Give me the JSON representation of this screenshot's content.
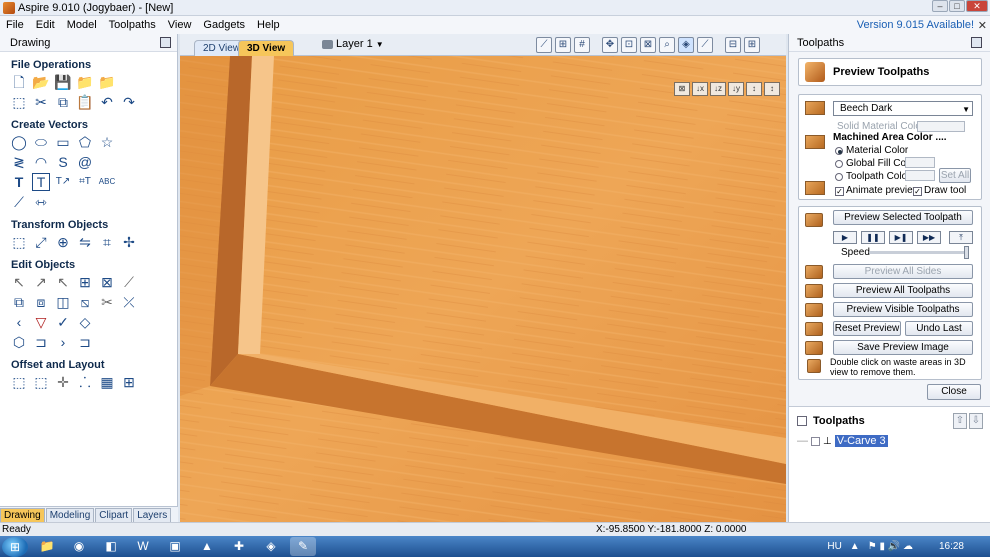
{
  "window": {
    "title": "Aspire 9.010 (Jogybaer) - [New]"
  },
  "menu": {
    "items": [
      "File",
      "Edit",
      "Model",
      "Toolpaths",
      "View",
      "Gadgets",
      "Help"
    ],
    "version_notice": "Version 9.015 Available!"
  },
  "left_panel": {
    "title": "Drawing",
    "sections": [
      {
        "title": "File Operations"
      },
      {
        "title": "Create Vectors"
      },
      {
        "title": "Transform Objects"
      },
      {
        "title": "Edit Objects"
      },
      {
        "title": "Offset and Layout"
      }
    ],
    "tabs": [
      "Drawing",
      "Modeling",
      "Clipart",
      "Layers"
    ]
  },
  "view": {
    "tabs": [
      "2D View",
      "3D View"
    ],
    "active_tab": "3D View",
    "layer_label": "Layer 1"
  },
  "status": {
    "left": "Ready",
    "coords": "X:-95.8500 Y:-181.8000 Z: 0.0000"
  },
  "right_panel": {
    "title": "Toolpaths",
    "preview_title": "Preview Toolpaths",
    "material": {
      "selected": "Beech Dark",
      "solid_color_label": "Solid Material Color"
    },
    "machined_area": {
      "title": "Machined Area Color ....",
      "options": [
        "Material Color",
        "Global Fill Color",
        "Toolpath Color"
      ],
      "selected": "Material Color",
      "set_all": "Set All"
    },
    "checks": {
      "animate": "Animate preview",
      "draw_tool": "Draw tool"
    },
    "buttons": {
      "preview_selected": "Preview Selected Toolpath",
      "speed": "Speed",
      "preview_all_sides": "Preview All Sides",
      "preview_all": "Preview All Toolpaths",
      "preview_visible": "Preview Visible Toolpaths",
      "reset": "Reset Preview",
      "undo_last": "Undo Last",
      "save_image": "Save Preview Image",
      "close": "Close"
    },
    "hint": "Double click on waste areas in 3D view to remove them.",
    "toolpaths_header": "Toolpaths",
    "toolpaths": [
      {
        "name": "V-Carve 3"
      }
    ]
  },
  "taskbar": {
    "lang": "HU",
    "time": "16:28"
  }
}
